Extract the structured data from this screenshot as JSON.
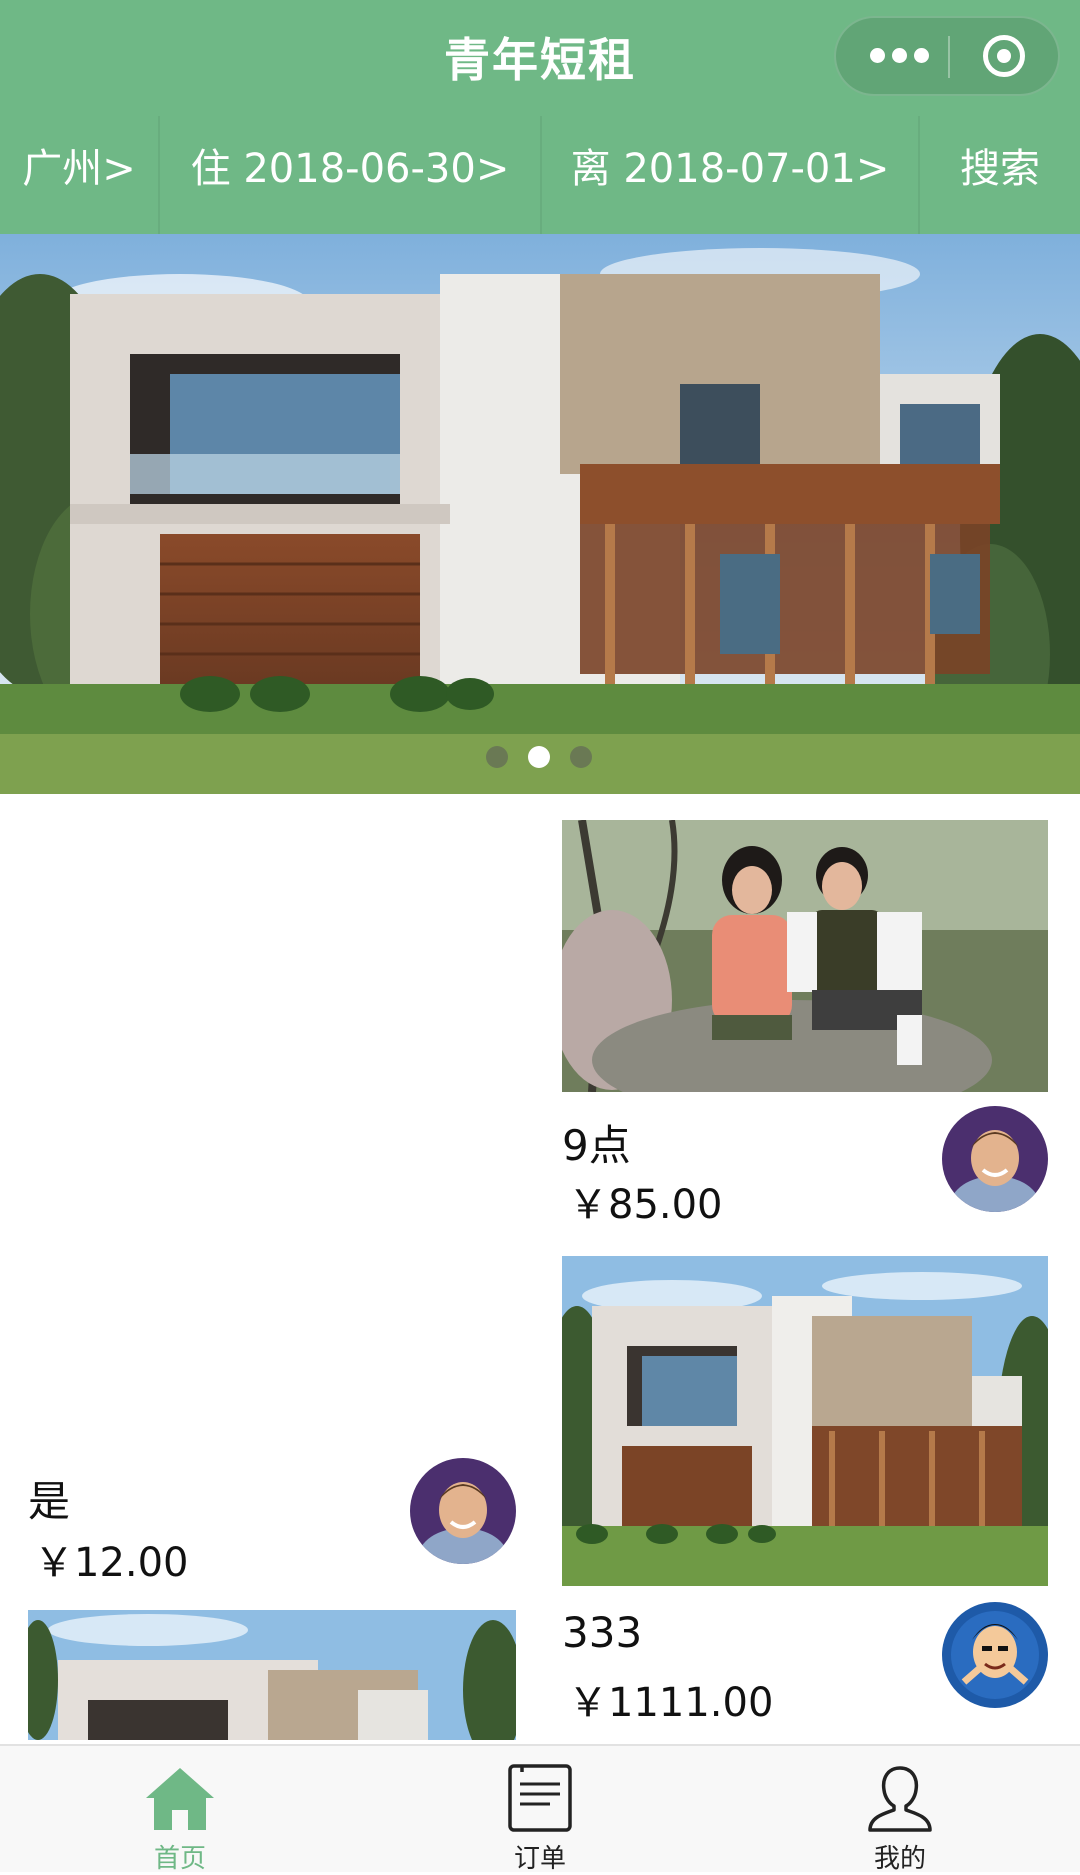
{
  "nav": {
    "title": "青年短租"
  },
  "filters": {
    "city": "广州>",
    "check_in": "住 2018-06-30>",
    "check_out": "离 2018-07-01>",
    "search": "搜索"
  },
  "banner": {
    "slide_count": 3,
    "active_slide": 2
  },
  "listings": [
    {
      "title": "是",
      "price": "￥12.00"
    },
    {
      "title": "9点",
      "price": "￥85.00"
    },
    {
      "title": "333",
      "price": "￥1111.00"
    }
  ],
  "tabbar": {
    "items": [
      {
        "label": "首页",
        "icon": "home-icon",
        "active": true
      },
      {
        "label": "订单",
        "icon": "order-icon",
        "active": false
      },
      {
        "label": "我的",
        "icon": "profile-icon",
        "active": false
      }
    ]
  },
  "colors": {
    "brand_green": "#6fb886",
    "tab_active": "#6fb886"
  }
}
